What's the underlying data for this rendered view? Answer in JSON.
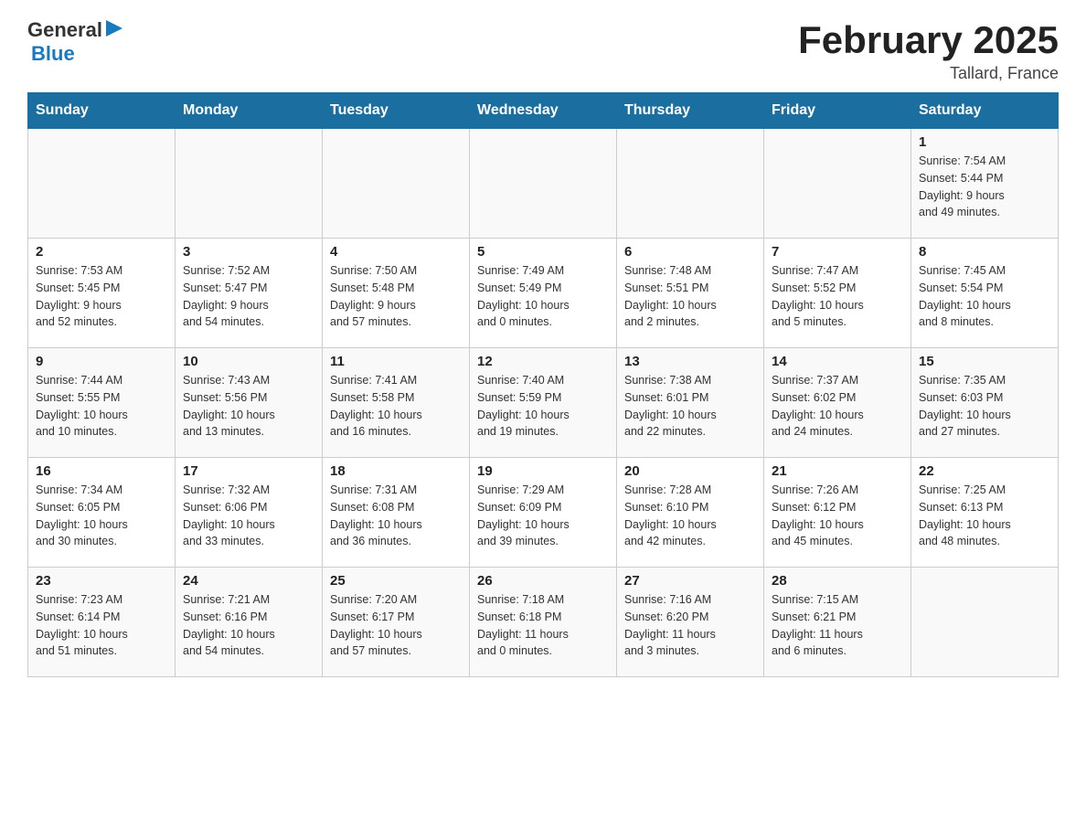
{
  "header": {
    "logo_general": "General",
    "logo_blue": "Blue",
    "month_title": "February 2025",
    "location": "Tallard, France"
  },
  "days_of_week": [
    "Sunday",
    "Monday",
    "Tuesday",
    "Wednesday",
    "Thursday",
    "Friday",
    "Saturday"
  ],
  "weeks": [
    {
      "days": [
        {
          "number": "",
          "info": ""
        },
        {
          "number": "",
          "info": ""
        },
        {
          "number": "",
          "info": ""
        },
        {
          "number": "",
          "info": ""
        },
        {
          "number": "",
          "info": ""
        },
        {
          "number": "",
          "info": ""
        },
        {
          "number": "1",
          "info": "Sunrise: 7:54 AM\nSunset: 5:44 PM\nDaylight: 9 hours\nand 49 minutes."
        }
      ]
    },
    {
      "days": [
        {
          "number": "2",
          "info": "Sunrise: 7:53 AM\nSunset: 5:45 PM\nDaylight: 9 hours\nand 52 minutes."
        },
        {
          "number": "3",
          "info": "Sunrise: 7:52 AM\nSunset: 5:47 PM\nDaylight: 9 hours\nand 54 minutes."
        },
        {
          "number": "4",
          "info": "Sunrise: 7:50 AM\nSunset: 5:48 PM\nDaylight: 9 hours\nand 57 minutes."
        },
        {
          "number": "5",
          "info": "Sunrise: 7:49 AM\nSunset: 5:49 PM\nDaylight: 10 hours\nand 0 minutes."
        },
        {
          "number": "6",
          "info": "Sunrise: 7:48 AM\nSunset: 5:51 PM\nDaylight: 10 hours\nand 2 minutes."
        },
        {
          "number": "7",
          "info": "Sunrise: 7:47 AM\nSunset: 5:52 PM\nDaylight: 10 hours\nand 5 minutes."
        },
        {
          "number": "8",
          "info": "Sunrise: 7:45 AM\nSunset: 5:54 PM\nDaylight: 10 hours\nand 8 minutes."
        }
      ]
    },
    {
      "days": [
        {
          "number": "9",
          "info": "Sunrise: 7:44 AM\nSunset: 5:55 PM\nDaylight: 10 hours\nand 10 minutes."
        },
        {
          "number": "10",
          "info": "Sunrise: 7:43 AM\nSunset: 5:56 PM\nDaylight: 10 hours\nand 13 minutes."
        },
        {
          "number": "11",
          "info": "Sunrise: 7:41 AM\nSunset: 5:58 PM\nDaylight: 10 hours\nand 16 minutes."
        },
        {
          "number": "12",
          "info": "Sunrise: 7:40 AM\nSunset: 5:59 PM\nDaylight: 10 hours\nand 19 minutes."
        },
        {
          "number": "13",
          "info": "Sunrise: 7:38 AM\nSunset: 6:01 PM\nDaylight: 10 hours\nand 22 minutes."
        },
        {
          "number": "14",
          "info": "Sunrise: 7:37 AM\nSunset: 6:02 PM\nDaylight: 10 hours\nand 24 minutes."
        },
        {
          "number": "15",
          "info": "Sunrise: 7:35 AM\nSunset: 6:03 PM\nDaylight: 10 hours\nand 27 minutes."
        }
      ]
    },
    {
      "days": [
        {
          "number": "16",
          "info": "Sunrise: 7:34 AM\nSunset: 6:05 PM\nDaylight: 10 hours\nand 30 minutes."
        },
        {
          "number": "17",
          "info": "Sunrise: 7:32 AM\nSunset: 6:06 PM\nDaylight: 10 hours\nand 33 minutes."
        },
        {
          "number": "18",
          "info": "Sunrise: 7:31 AM\nSunset: 6:08 PM\nDaylight: 10 hours\nand 36 minutes."
        },
        {
          "number": "19",
          "info": "Sunrise: 7:29 AM\nSunset: 6:09 PM\nDaylight: 10 hours\nand 39 minutes."
        },
        {
          "number": "20",
          "info": "Sunrise: 7:28 AM\nSunset: 6:10 PM\nDaylight: 10 hours\nand 42 minutes."
        },
        {
          "number": "21",
          "info": "Sunrise: 7:26 AM\nSunset: 6:12 PM\nDaylight: 10 hours\nand 45 minutes."
        },
        {
          "number": "22",
          "info": "Sunrise: 7:25 AM\nSunset: 6:13 PM\nDaylight: 10 hours\nand 48 minutes."
        }
      ]
    },
    {
      "days": [
        {
          "number": "23",
          "info": "Sunrise: 7:23 AM\nSunset: 6:14 PM\nDaylight: 10 hours\nand 51 minutes."
        },
        {
          "number": "24",
          "info": "Sunrise: 7:21 AM\nSunset: 6:16 PM\nDaylight: 10 hours\nand 54 minutes."
        },
        {
          "number": "25",
          "info": "Sunrise: 7:20 AM\nSunset: 6:17 PM\nDaylight: 10 hours\nand 57 minutes."
        },
        {
          "number": "26",
          "info": "Sunrise: 7:18 AM\nSunset: 6:18 PM\nDaylight: 11 hours\nand 0 minutes."
        },
        {
          "number": "27",
          "info": "Sunrise: 7:16 AM\nSunset: 6:20 PM\nDaylight: 11 hours\nand 3 minutes."
        },
        {
          "number": "28",
          "info": "Sunrise: 7:15 AM\nSunset: 6:21 PM\nDaylight: 11 hours\nand 6 minutes."
        },
        {
          "number": "",
          "info": ""
        }
      ]
    }
  ]
}
